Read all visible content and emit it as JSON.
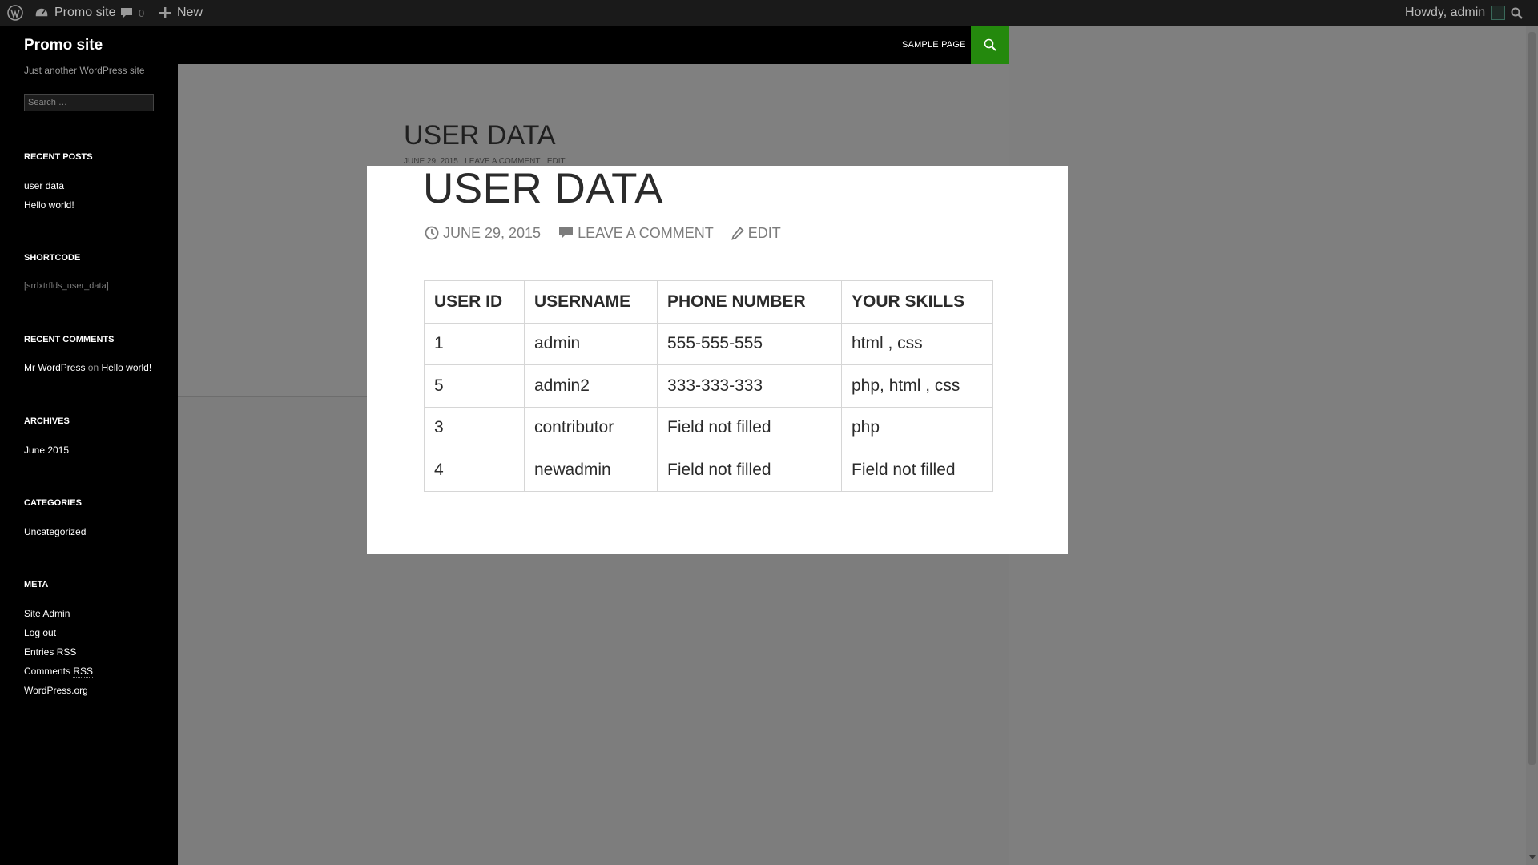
{
  "adminbar": {
    "site_name": "Promo site",
    "comments_count": "0",
    "new_label": "New",
    "greeting": "Howdy, admin"
  },
  "header": {
    "site_title": "Promo site",
    "nav_sample_page": "SAMPLE PAGE"
  },
  "sidebar": {
    "tagline": "Just another WordPress site",
    "search_placeholder": "Search …",
    "recent_posts": {
      "title": "RECENT POSTS",
      "items": [
        "user data",
        "Hello world!"
      ]
    },
    "shortcode": {
      "title": "SHORTCODE",
      "text": "[srrlxtrflds_user_data]"
    },
    "recent_comments": {
      "title": "RECENT COMMENTS",
      "author": "Mr WordPress",
      "on": "on",
      "post": "Hello world!"
    },
    "archives": {
      "title": "ARCHIVES",
      "items": [
        "June 2015"
      ]
    },
    "categories": {
      "title": "CATEGORIES",
      "items": [
        "Uncategorized"
      ]
    },
    "meta": {
      "title": "META",
      "site_admin": "Site Admin",
      "log_out": "Log out",
      "entries": "Entries",
      "comments": "Comments",
      "rss": "RSS",
      "wordpress_org": "WordPress.org"
    }
  },
  "post": {
    "title": "USER DATA"
  },
  "modal": {
    "title": "USER DATA",
    "date": "JUNE 29, 2015",
    "leave_comment": "LEAVE A COMMENT",
    "edit": "EDIT",
    "table": {
      "headers": [
        "USER ID",
        "USERNAME",
        "PHONE NUMBER",
        "YOUR SKILLS"
      ],
      "rows": [
        [
          "1",
          "admin",
          "555-555-555",
          "html , css"
        ],
        [
          "5",
          "admin2",
          "333-333-333",
          "php, html , css"
        ],
        [
          "3",
          "contributor",
          "Field not filled",
          "php"
        ],
        [
          "4",
          "newadmin",
          "Field not filled",
          "Field not filled"
        ]
      ]
    }
  },
  "colors": {
    "admin_bar": "#1a1a1a",
    "accent_green": "#24890d",
    "overlay_gray": "#7f7f7f"
  }
}
